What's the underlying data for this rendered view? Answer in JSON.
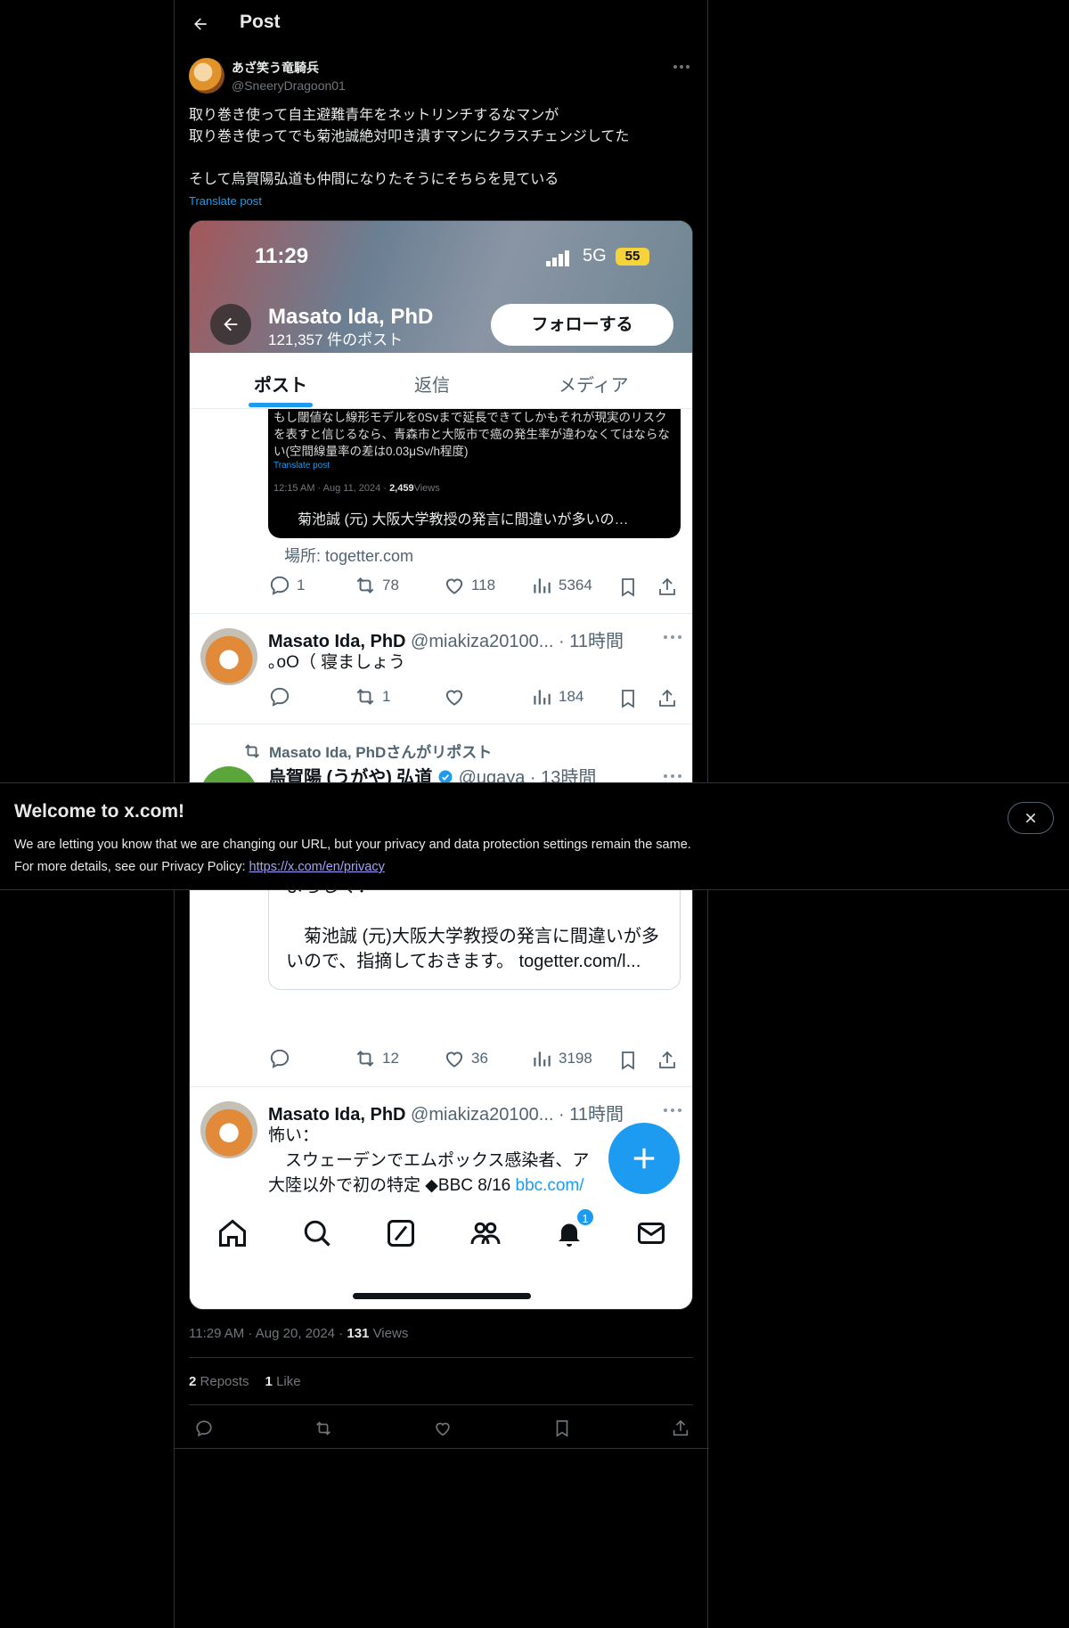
{
  "header": {
    "title": "Post"
  },
  "author": {
    "name": "あざ笑う竜騎兵",
    "handle": "@SneeryDragoon01"
  },
  "post": {
    "text": "取り巻き使って自主避難青年をネットリンチするなマンが\n取り巻き使ってでも菊池誠絶対叩き潰すマンにクラスチェンジしてた\n\nそして烏賀陽弘道も仲間になりたそうにそちらを見ている",
    "translate_label": "Translate post",
    "time": "11:29 AM",
    "date": "Aug 20, 2024",
    "views_count": "131",
    "views_label": "Views",
    "reposts_count": "2",
    "reposts_label": "Reposts",
    "likes_count": "1",
    "likes_label": "Like"
  },
  "media": {
    "status_time": "11:29",
    "network": "5G",
    "battery": "55",
    "profile_name": "Masato Ida, PhD",
    "profile_posts": "121,357 件のポスト",
    "follow_label": "フォローする",
    "tabs": [
      {
        "label": "ポスト"
      },
      {
        "label": "返信"
      },
      {
        "label": "メディア"
      }
    ],
    "quote_card": {
      "text": "もし閾値なし線形モデルを0Svまで延長できてしかもそれが現実のリスクを表すと信じるなら、青森市と大阪市で癌の発生率が違わなくてはならない(空間線量率の差は0.03μSv/h程度)",
      "translate": "Translate post",
      "meta_time": "12:15 AM · Aug 11, 2024 · ",
      "meta_views_count": "2,459",
      "meta_views_label": "Views",
      "link_text": "菊池誠 (元) 大阪大学教授の発言に間違いが多いの…"
    },
    "link_domain": "場所: togetter.com",
    "row1_actions": {
      "replies": "1",
      "reposts": "78",
      "likes": "118",
      "views": "5364"
    },
    "row2": {
      "name": "Masato Ida, PhD",
      "handle": "@miakiza20100... · 11時間",
      "text": "｡oO（ 寝ましょう",
      "reposts": "1",
      "views": "184"
    },
    "row3": {
      "repost_note": "Masato Ida, PhDさんがリポスト",
      "name": "烏賀陽 (うがや) 弘道",
      "handle": "@ugaya · 13時間",
      "quote_text": "急遽、以下のマトメを作りましたので、どうぞよろしく：\n\n　菊池誠 (元)大阪大学教授の発言に間違いが多いので、指摘しておきます。 togetter.com/l...",
      "reposts": "12",
      "likes": "36",
      "views": "3198"
    },
    "row4": {
      "name": "Masato Ida, PhD",
      "handle": "@miakiza20100... · 11時間",
      "text": "怖い：\n　スウェーデンでエムポックス感染者、ア\n大陸以外で初の特定 ◆BBC 8/16 ",
      "link": "bbc.com/"
    },
    "notification_badge": "1"
  },
  "banner": {
    "title": "Welcome to x.com!",
    "line1": "We are letting you know that we are changing our URL, but your privacy and data protection settings remain the same.",
    "line2": "For more details, see our Privacy Policy: ",
    "link": "https://x.com/en/privacy"
  },
  "colors": {
    "accent": "#1d9bf0",
    "background": "#000000",
    "muted": "#71767b",
    "battery": "#f7d33b"
  }
}
